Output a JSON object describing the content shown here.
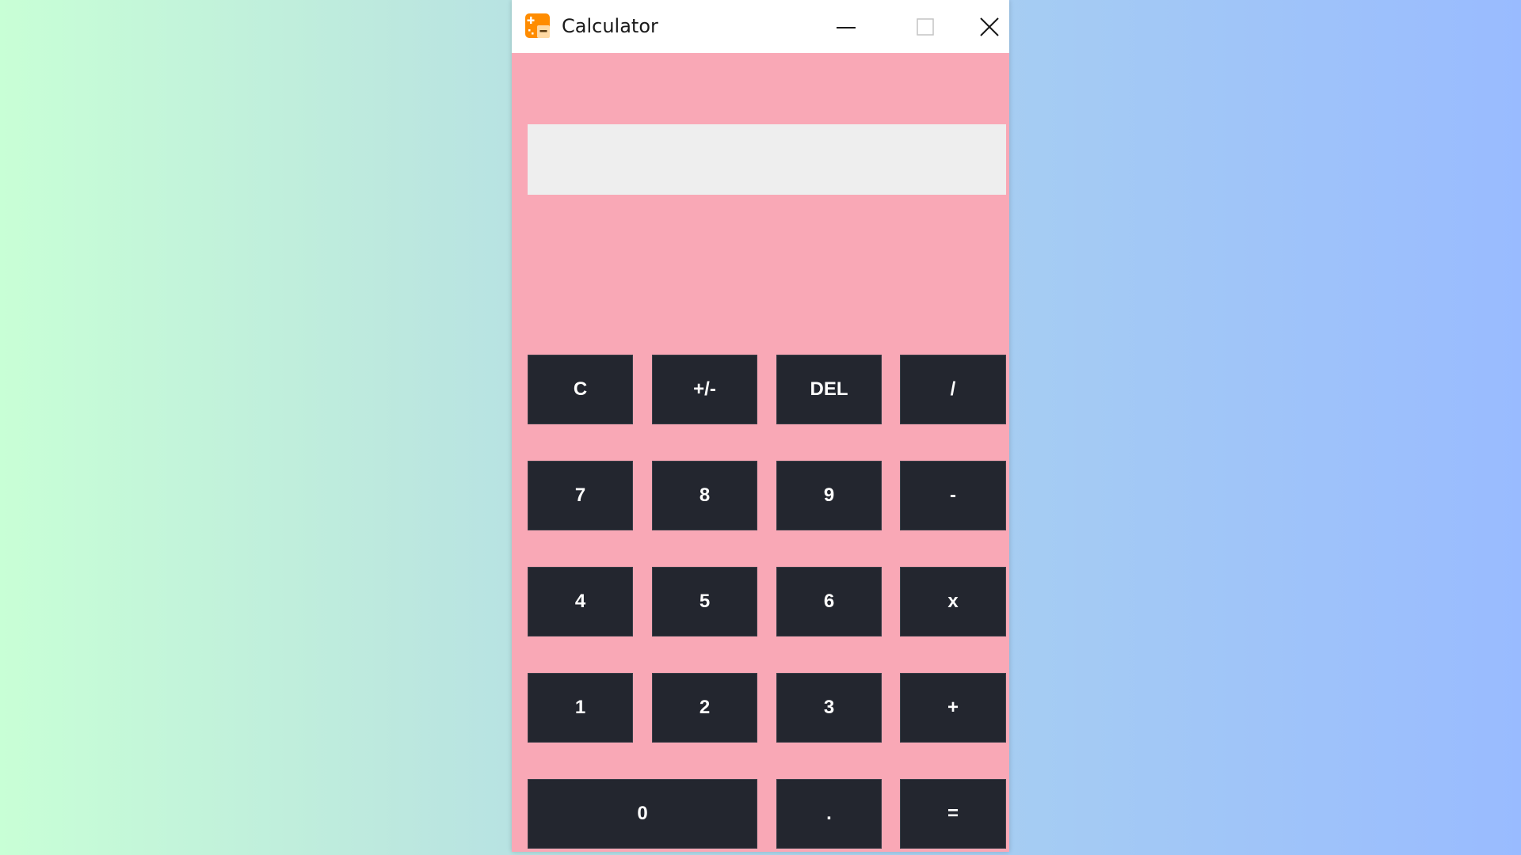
{
  "window": {
    "title": "Calculator",
    "app_icon": "calculator-app-icon",
    "controls": {
      "minimize_icon": "minimize-icon",
      "maximize_icon": "maximize-icon",
      "close_icon": "close-icon"
    }
  },
  "display": {
    "value": "",
    "placeholder": ""
  },
  "keypad": {
    "rows": [
      [
        "C",
        "+/-",
        "DEL",
        "/"
      ],
      [
        "7",
        "8",
        "9",
        "-"
      ],
      [
        "4",
        "5",
        "6",
        "x"
      ],
      [
        "1",
        "2",
        "3",
        "+"
      ],
      [
        "0",
        ".",
        "="
      ]
    ]
  },
  "colors": {
    "window_background": "#f9a8b6",
    "titlebar": "#ffffff",
    "display_background": "#eeeeee",
    "key_background": "#23262f",
    "key_text": "#ffffff",
    "app_icon_accent": "#ff8c00"
  }
}
